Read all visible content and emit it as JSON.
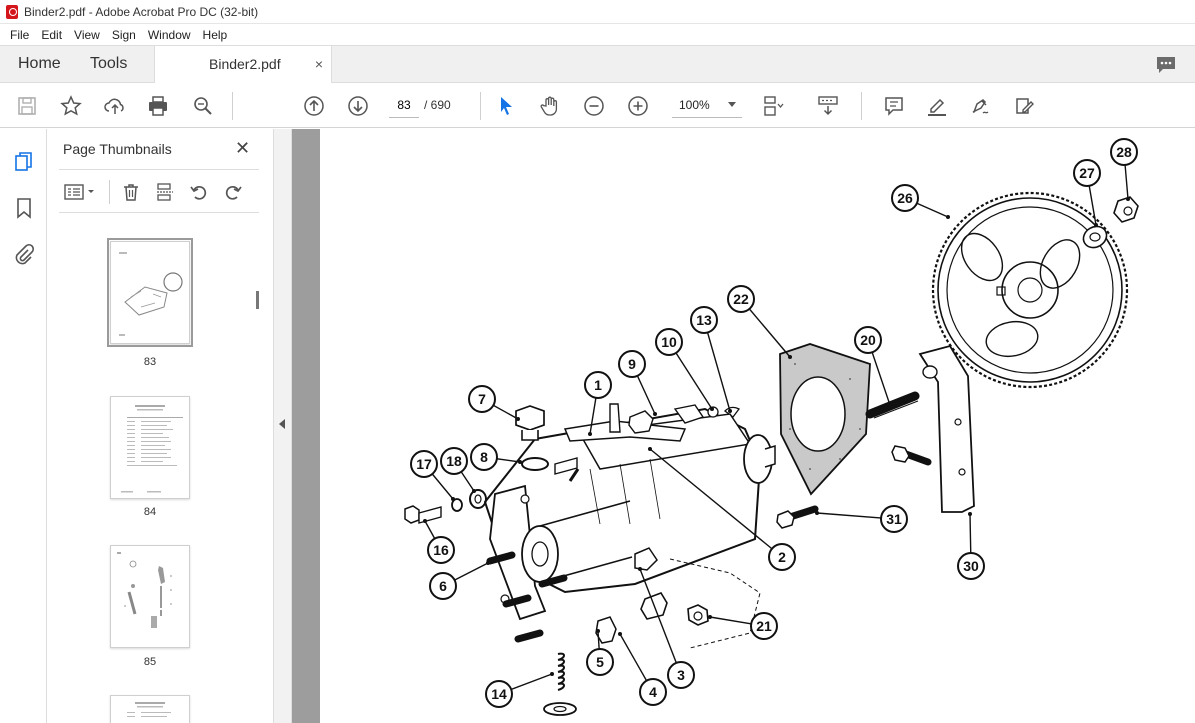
{
  "window": {
    "title": "Binder2.pdf - Adobe Acrobat Pro DC (32-bit)"
  },
  "menu": [
    "File",
    "Edit",
    "View",
    "Sign",
    "Window",
    "Help"
  ],
  "tabs": {
    "home": "Home",
    "tools": "Tools",
    "document": "Binder2.pdf",
    "close": "×"
  },
  "toolbar": {
    "page_current": "83",
    "page_total": "/ 690",
    "zoom": "100%"
  },
  "panel": {
    "title": "Page Thumbnails",
    "close": "✕",
    "thumbnails": [
      {
        "label": "83",
        "selected": true
      },
      {
        "label": "84",
        "selected": false
      },
      {
        "label": "85",
        "selected": false
      },
      {
        "label": "",
        "selected": false
      }
    ]
  },
  "diagram": {
    "callouts": [
      "1",
      "2",
      "3",
      "4",
      "5",
      "6",
      "7",
      "8",
      "9",
      "10",
      "13",
      "14",
      "16",
      "17",
      "18",
      "20",
      "21",
      "22",
      "26",
      "27",
      "28",
      "30",
      "31"
    ]
  },
  "colors": {
    "accent": "#1473e6",
    "pdf_red": "#d4161c"
  },
  "icons": [
    "save-icon",
    "bookmark-star-icon",
    "upload-icon",
    "print-icon",
    "zoom-search-icon",
    "page-up-icon",
    "page-down-icon",
    "select-cursor-icon",
    "hand-icon",
    "zoom-out-icon",
    "zoom-in-icon",
    "fit-page-icon",
    "scroll-mode-icon",
    "comment-icon",
    "highlight-icon",
    "sign-icon",
    "edit-pdf-icon"
  ]
}
